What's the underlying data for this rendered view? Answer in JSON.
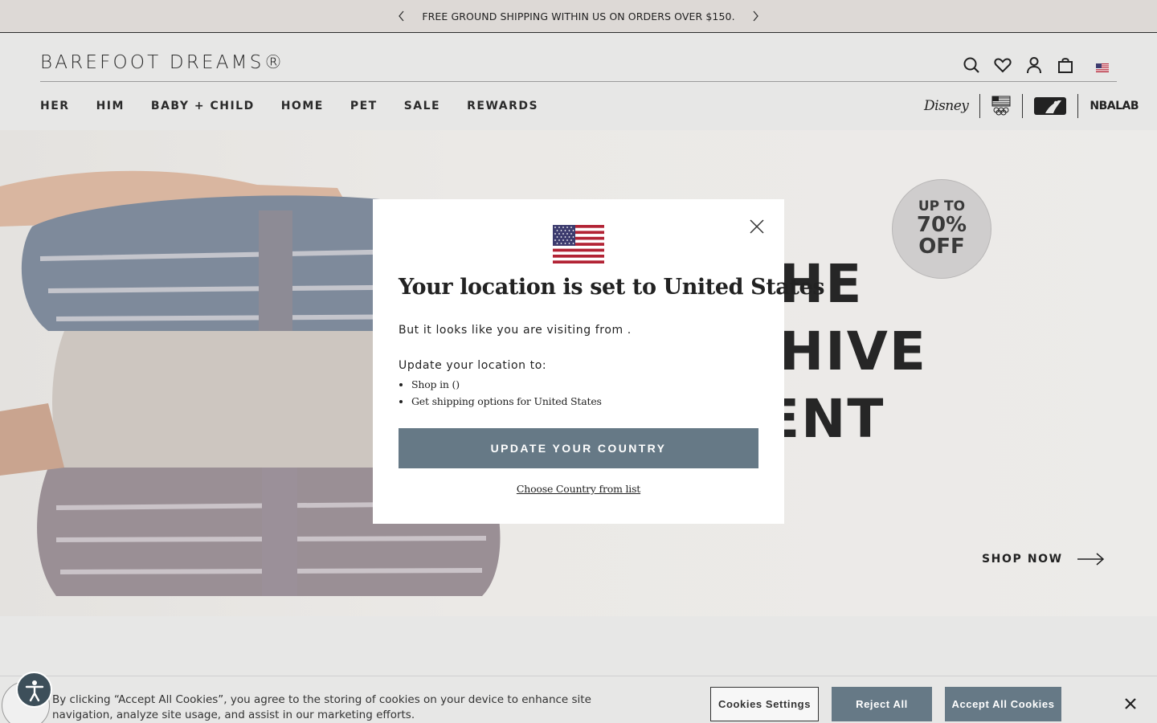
{
  "announcement": {
    "text": "FREE GROUND SHIPPING WITHIN US ON ORDERS OVER $150."
  },
  "header": {
    "logo_text": "BAREFOOT DREAMS®",
    "nav": [
      {
        "label": "HER"
      },
      {
        "label": "HIM"
      },
      {
        "label": "BABY + CHILD"
      },
      {
        "label": "HOME"
      },
      {
        "label": "PET"
      },
      {
        "label": "SALE"
      },
      {
        "label": "REWARDS"
      }
    ],
    "utility_icons": [
      "search-icon",
      "heart-icon",
      "account-icon",
      "bag-icon",
      "us-flag-icon"
    ],
    "partners": [
      "Disney",
      "Team USA",
      "MLB",
      "NBA LAB"
    ],
    "partner_labels": {
      "disney": "Disney",
      "nba": "NBALAB"
    }
  },
  "hero": {
    "headline_lines": [
      "HE",
      "HIVE",
      "ENT"
    ],
    "badge": {
      "line1": "UP TO",
      "line2": "70%",
      "line3": "OFF"
    },
    "cta": "SHOP NOW"
  },
  "modal": {
    "title": "Your location is set to United States",
    "visiting_text": "But it looks like you are visiting from .",
    "update_prompt": "Update your location to:",
    "options": [
      "Shop in ()",
      "Get shipping options for United States"
    ],
    "button_label": "UPDATE YOUR COUNTRY",
    "choose_link": "Choose Country from list"
  },
  "cookie": {
    "text": "By clicking “Accept All Cookies”, you agree to the storing of cookies on your device to enhance site navigation, analyze site usage, and assist in our marketing efforts.",
    "settings_label": "Cookies Settings",
    "reject_label": "Reject All",
    "accept_label": "Accept All Cookies"
  },
  "colors": {
    "accent": "#667986",
    "background": "#e7e7e6",
    "text": "#222222"
  }
}
